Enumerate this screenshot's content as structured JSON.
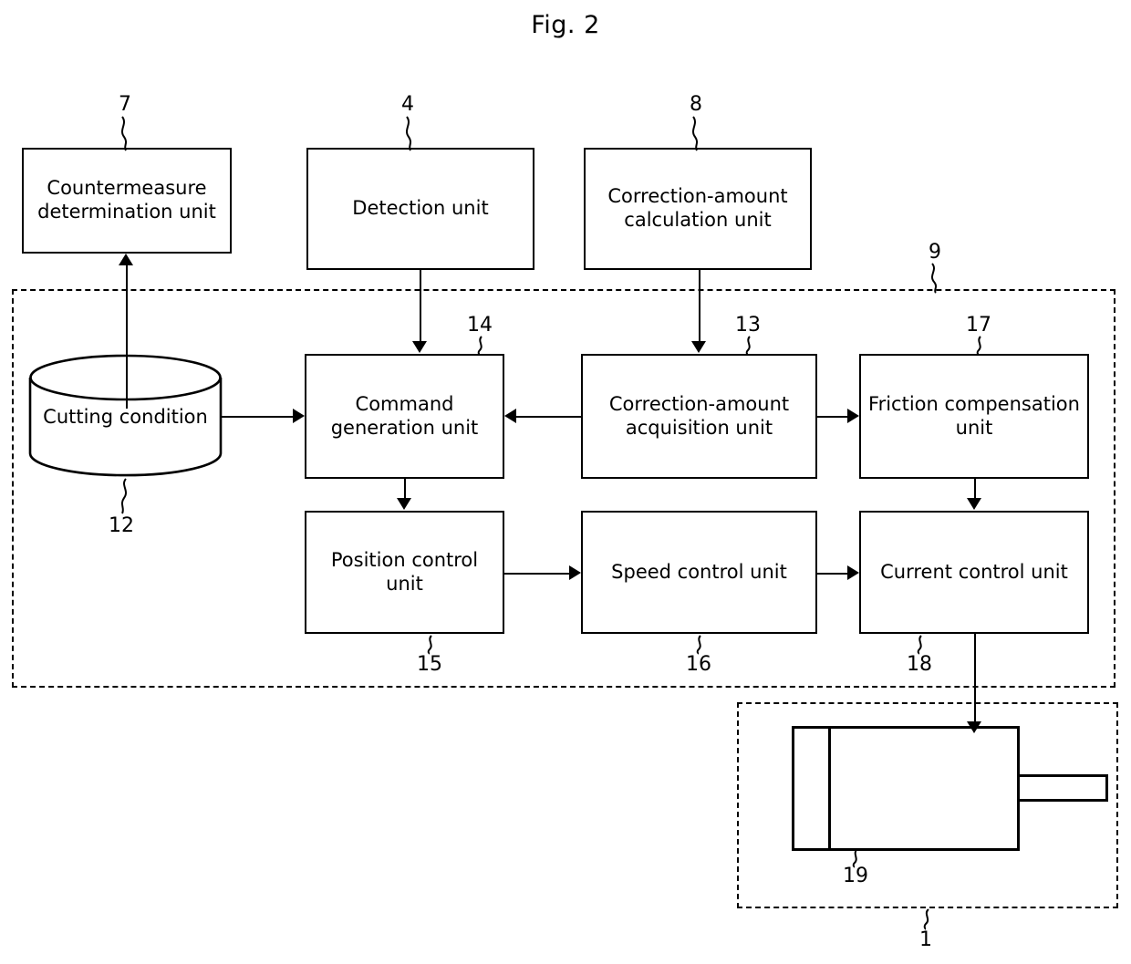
{
  "figure": {
    "title": "Fig. 2",
    "kind": "block-diagram"
  },
  "blocks": {
    "countermeasure": {
      "label": "Countermeasure determination unit",
      "ref": "7"
    },
    "detection": {
      "label": "Detection unit",
      "ref": "4"
    },
    "correction_calc": {
      "label": "Correction-amount calculation unit",
      "ref": "8"
    },
    "cutting_condition": {
      "label": "Cutting condition",
      "ref": "12"
    },
    "command_generation": {
      "label": "Command generation unit",
      "ref": "14"
    },
    "correction_acquisition": {
      "label": "Correction-amount acquisition unit",
      "ref": "13"
    },
    "friction_compensation": {
      "label": "Friction compensation unit",
      "ref": "17"
    },
    "position_control": {
      "label": "Position control unit",
      "ref": "15"
    },
    "speed_control": {
      "label": "Speed control unit",
      "ref": "16"
    },
    "current_control": {
      "label": "Current control unit",
      "ref": "18"
    }
  },
  "enclosures": {
    "controller": {
      "ref": "9"
    },
    "machine": {
      "ref": "1"
    }
  },
  "motor": {
    "ref": "19"
  },
  "colors": {
    "line": "#000000",
    "background": "#ffffff",
    "text": "#000000"
  }
}
